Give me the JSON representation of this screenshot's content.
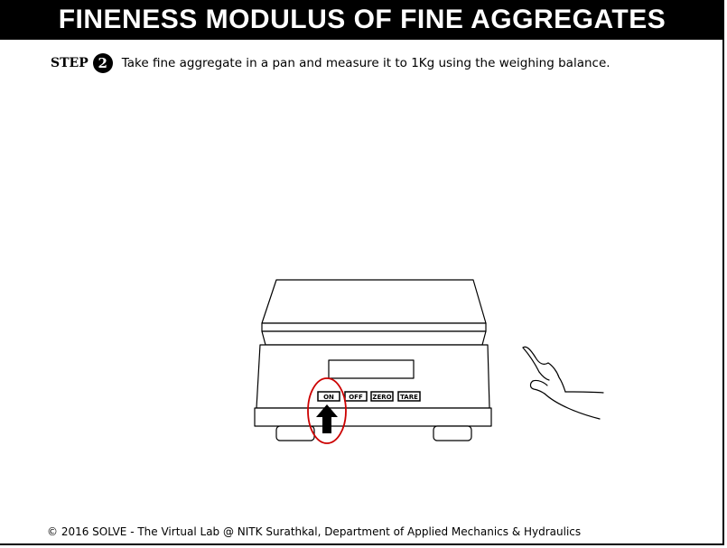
{
  "title": "FINENESS MODULUS OF FINE AGGREGATES",
  "step": {
    "label": "STEP",
    "number": "2",
    "instruction": "Take fine aggregate in a pan and measure it to 1Kg using the weighing balance."
  },
  "balance": {
    "buttons": {
      "on": "ON",
      "off": "OFF",
      "zero": "ZERO",
      "tare": "TARE"
    },
    "highlight_color": "#cc0000"
  },
  "footer": "© 2016 SOLVE - The Virtual Lab @ NITK Surathkal, Department of Applied Mechanics & Hydraulics"
}
